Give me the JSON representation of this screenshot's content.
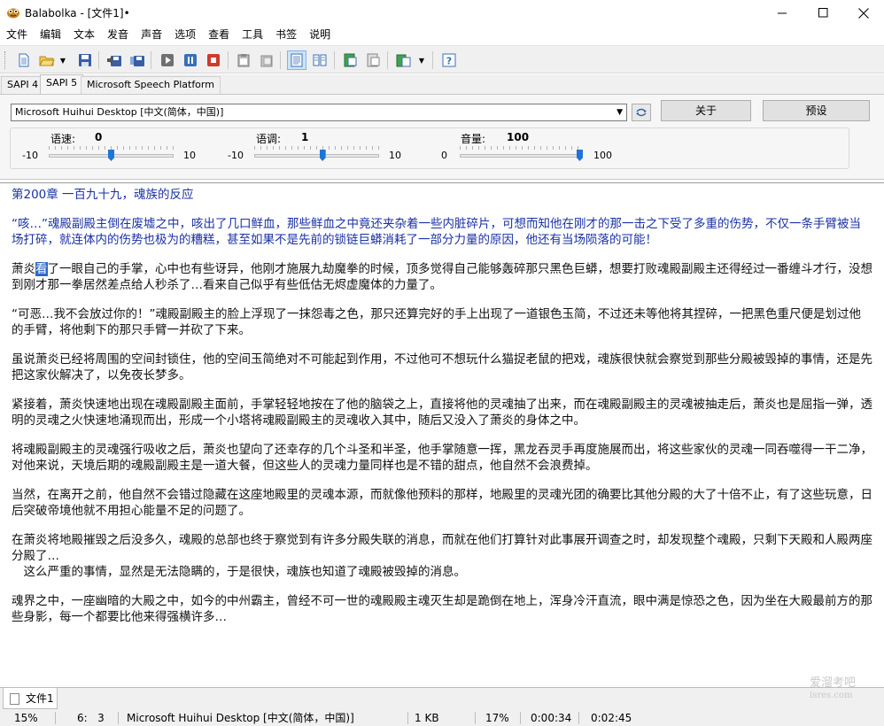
{
  "window": {
    "title": "Balabolka - [文件1]•",
    "minimize_glyph": "─",
    "maximize_glyph": "☐",
    "close_glyph": "✕"
  },
  "menu": [
    "文件",
    "编辑",
    "文本",
    "发音",
    "声音",
    "选项",
    "查看",
    "工具",
    "书签",
    "说明"
  ],
  "toolbar_icons": [
    "new-file-icon",
    "open-folder-icon",
    "save-icon",
    "save-audio-icon",
    "save-audio-split-icon",
    "play-icon",
    "pause-icon",
    "stop-icon",
    "clipboard-read-icon",
    "clipboard-stop-icon",
    "text-view-icon",
    "speech-settings-icon",
    "dictionary-icon",
    "dictionary-edit-icon",
    "audio-file-icon",
    "help-icon"
  ],
  "tabs": [
    "SAPI 4",
    "SAPI 5",
    "Microsoft Speech Platform"
  ],
  "voice": {
    "selected": "Microsoft Huihui Desktop [中文(简体，中国)]",
    "about_label": "关于",
    "preset_label": "预设"
  },
  "sliders": {
    "rate": {
      "label": "语速:",
      "value": "0",
      "min": "-10",
      "max": "10",
      "fraction": 0.5
    },
    "pitch": {
      "label": "语调:",
      "value": "1",
      "min": "-10",
      "max": "10",
      "fraction": 0.55
    },
    "volume": {
      "label": "音量:",
      "value": "100",
      "min": "0",
      "max": "100",
      "fraction": 1.0
    }
  },
  "document": {
    "paragraphs": [
      {
        "text": "第200章 一百九十九，魂族的反应"
      },
      {
        "text": "“咳…”魂殿副殿主倒在废墟之中，咳出了几口鲜血，那些鲜血之中竟还夹杂着一些内脏碎片，可想而知他在刚才的那一击之下受了多重的伤势，不仅一条手臂被当场打碎，就连体内的伤势也极为的糟糕，甚至如果不是先前的锁链巨蟒消耗了一部分力量的原因，他还有当场陨落的可能！"
      },
      {
        "before": "萧炎",
        "highlight": "看",
        "after": "了一眼自己的手掌，心中也有些讶异，他刚才施展九劫魔拳的时候，顶多觉得自己能够轰碎那只黑色巨蟒，想要打败魂殿副殿主还得经过一番缠斗才行，没想到刚才那一拳居然差点给人秒杀了…看来自己似乎有些低估无烬虚魔体的力量了。"
      },
      {
        "text": "“可恶…我不会放过你的！”魂殿副殿主的脸上浮现了一抹怨毒之色，那只还算完好的手上出现了一道银色玉简，不过还未等他将其捏碎，一把黑色重尺便是划过他的手臂，将他剩下的那只手臂一并砍了下来。"
      },
      {
        "text": "虽说萧炎已经将周围的空间封锁住，他的空间玉简绝对不可能起到作用，不过他可不想玩什么猫捉老鼠的把戏，魂族很快就会察觉到那些分殿被毁掉的事情，还是先把这家伙解决了，以免夜长梦多。"
      },
      {
        "text": "紧接着，萧炎快速地出现在魂殿副殿主面前，手掌轻轻地按在了他的脑袋之上，直接将他的灵魂抽了出来，而在魂殿副殿主的灵魂被抽走后，萧炎也是屈指一弹，透明的灵魂之火快速地涌现而出，形成一个小塔将魂殿副殿主的灵魂收入其中，随后又没入了萧炎的身体之中。"
      },
      {
        "text": "将魂殿副殿主的灵魂强行吸收之后，萧炎也望向了还幸存的几个斗圣和半圣，他手掌随意一挥，黑龙吞灵手再度施展而出，将这些家伙的灵魂一同吞噬得一干二净，对他来说，天境后期的魂殿副殿主是一道大餐，但这些人的灵魂力量同样也是不错的甜点，他自然不会浪费掉。"
      },
      {
        "text": "当然，在离开之前，他自然不会错过隐藏在这座地殿里的灵魂本源，而就像他预料的那样，地殿里的灵魂光团的确要比其他分殿的大了十倍不止，有了这些玩意，日后突破帝境他就不用担心能量不足的问题了。"
      },
      {
        "text": "在萧炎将地殿摧毁之后没多久，魂殿的总部也终于察觉到有许多分殿失联的消息，而就在他们打算针对此事展开调查之时，却发现整个魂殿，只剩下天殿和人殿两座分殿了…\n　这么严重的事情，显然是无法隐瞒的，于是很快，魂族也知道了魂殿被毁掉的消息。"
      },
      {
        "text": "魂界之中，一座幽暗的大殿之中，如今的中州霸主，曾经不可一世的魂殿殿主魂灭生却是跪倒在地上，浑身冷汗直流，眼中满是惊恐之色，因为坐在大殿最前方的那些身影，每一个都要比他来得强横许多…"
      }
    ]
  },
  "doc_tab": "文件1",
  "watermark": {
    "line1": "爱溜考吧",
    "line2": "isres.com"
  },
  "status": {
    "zoom": "15%",
    "position": "6:   3",
    "voice": "Microsoft Huihui Desktop [中文(简体，中国)]",
    "size": "1 KB",
    "progress": "17%",
    "elapsed": "0:00:34",
    "total": "0:02:45"
  },
  "colors": {
    "heading_text": "#1a31a6",
    "slider_thumb": "#1f75d6",
    "selection": "#2f66c9"
  }
}
